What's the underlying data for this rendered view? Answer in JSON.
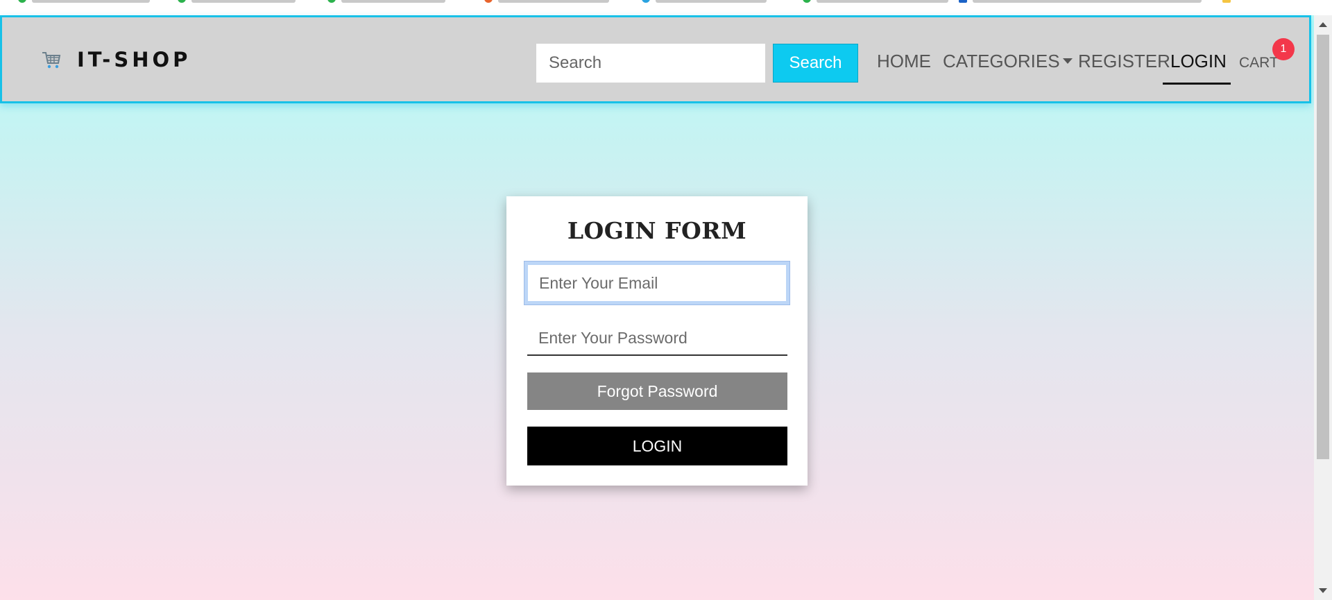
{
  "brand": {
    "name": "IT-SHOP",
    "icon": "shopping-cart-icon"
  },
  "search": {
    "placeholder": "Search",
    "value": "",
    "button_label": "Search"
  },
  "nav": {
    "items": [
      {
        "label": "HOME"
      },
      {
        "label": "CATEGORIES"
      },
      {
        "label": "REGISTER"
      },
      {
        "label": "LOGIN",
        "active": true
      }
    ],
    "cart_label": "CART",
    "cart_count": "1"
  },
  "login_form": {
    "title": "LOGIN FORM",
    "email_placeholder": "Enter Your Email",
    "email_value": "",
    "password_placeholder": "Enter Your Password",
    "password_value": "",
    "forgot_label": "Forgot Password",
    "submit_label": "LOGIN"
  },
  "colors": {
    "accent": "#0dcaf0",
    "navbar_bg": "#d3d3d3",
    "badge": "#f3374a",
    "forgot_button": "#858585",
    "login_button": "#000000"
  }
}
